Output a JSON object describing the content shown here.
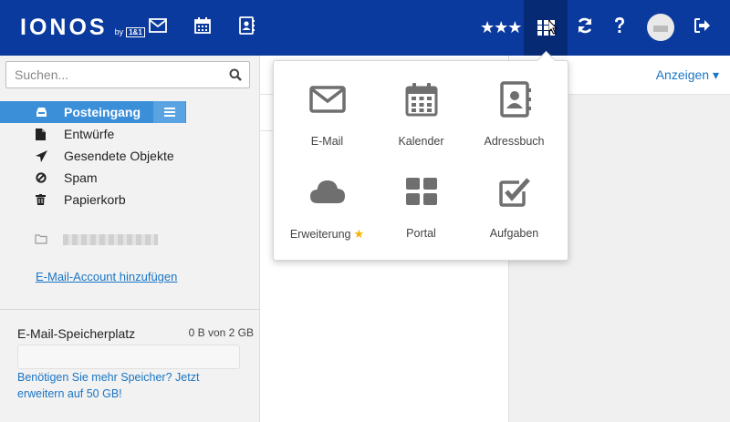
{
  "header": {
    "logo_main": "IONOS",
    "logo_by": "by",
    "logo_badge": "1&1",
    "rating_stars": "★★★",
    "icons": [
      "mail-icon",
      "calendar-icon",
      "addressbook-icon",
      "apps-grid-icon",
      "refresh-icon",
      "help-icon",
      "avatar",
      "logout-icon"
    ]
  },
  "search": {
    "placeholder": "Suchen..."
  },
  "folders": [
    {
      "label": "Posteingang",
      "icon": "inbox-icon",
      "active": true
    },
    {
      "label": "Entwürfe",
      "icon": "draft-icon"
    },
    {
      "label": "Gesendete Objekte",
      "icon": "paper-plane-icon"
    },
    {
      "label": "Spam",
      "icon": "ban-icon"
    },
    {
      "label": "Papierkorb",
      "icon": "trash-icon"
    }
  ],
  "add_account_label": "E-Mail-Account hinzufügen",
  "storage": {
    "title": "E-Mail-Speicherplatz",
    "value": "0 B von 2 GB",
    "used_fraction": 0,
    "upgrade_text": "Benötigen Sie mehr Speicher? Jetzt erweitern auf 50 GB!"
  },
  "toolbar": {
    "anzeigen_label": "Anzeigen ▾"
  },
  "apps_menu": [
    {
      "label": "E-Mail",
      "icon": "mail-icon"
    },
    {
      "label": "Kalender",
      "icon": "calendar-icon"
    },
    {
      "label": "Adressbuch",
      "icon": "addressbook-icon"
    },
    {
      "label": "Erweiterung",
      "icon": "cloud-icon",
      "badge": "★"
    },
    {
      "label": "Portal",
      "icon": "portal-grid-icon"
    },
    {
      "label": "Aufgaben",
      "icon": "task-checkbox-icon"
    }
  ],
  "colors": {
    "header_bg": "#0b3a9e",
    "active_folder": "#3b8fd9",
    "link": "#1a75c4",
    "app_icon_gray": "#6f6f6f"
  }
}
